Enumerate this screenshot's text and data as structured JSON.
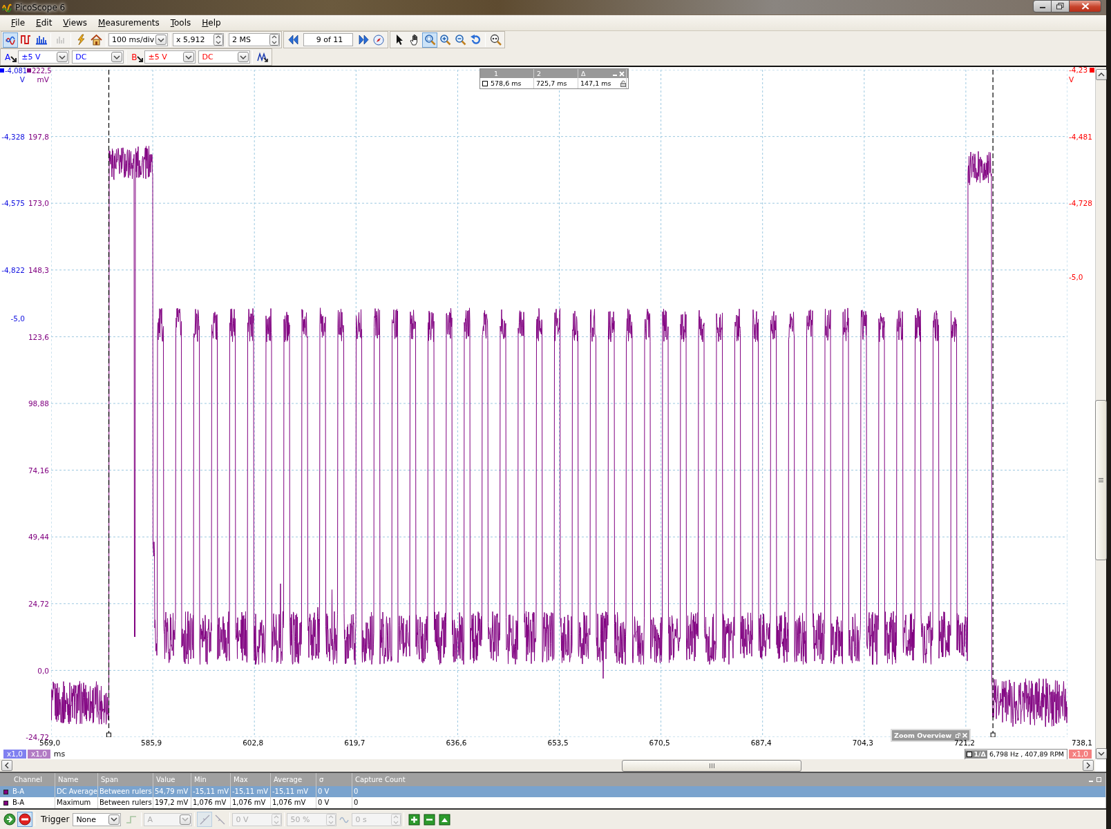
{
  "window": {
    "title": "PicoScope 6"
  },
  "menu": [
    {
      "label": "File"
    },
    {
      "label": "Edit"
    },
    {
      "label": "Views"
    },
    {
      "label": "Measurements"
    },
    {
      "label": "Tools"
    },
    {
      "label": "Help"
    }
  ],
  "toolbar": {
    "views": [
      {
        "selected": true,
        "disabled": false
      },
      {
        "selected": false,
        "disabled": false
      },
      {
        "selected": false,
        "disabled": false
      },
      {
        "selected": false,
        "disabled": true
      }
    ],
    "timebase": "100 ms/div",
    "zoom": "x 5,912",
    "samples": "2 MS",
    "buffer": "9  of 11",
    "tools": [
      {
        "selected": false
      },
      {
        "selected": false
      },
      {
        "selected": true
      },
      {
        "selected": false
      },
      {
        "selected": false
      },
      {
        "selected": false
      }
    ]
  },
  "channels": [
    {
      "name": "A",
      "range": "±5 V",
      "coupling": "DC",
      "color": "#0000ff"
    },
    {
      "name": "B",
      "range": "±5 V",
      "coupling": "DC",
      "color": "#ff0000"
    }
  ],
  "rulers": {
    "headers": [
      "1",
      "2",
      "Δ"
    ],
    "values": [
      "578,6 ms",
      "725,7 ms",
      "147,1 ms"
    ]
  },
  "scope": {
    "axis_a": {
      "unit": "V",
      "labels": [
        "-4,081",
        "-4,328",
        "-4,575",
        "-4,822",
        "-5,0"
      ]
    },
    "axis_math": {
      "unit": "mV",
      "labels": [
        "222,5",
        "197,8",
        "173,0",
        "148,3",
        "123,6",
        "98,88",
        "74,16",
        "49,44",
        "24,72",
        "0,0",
        "-24,72"
      ]
    },
    "axis_b": {
      "unit": "V",
      "labels": [
        "-4,23",
        "-4,481",
        "-4,728",
        "-5,0"
      ]
    },
    "x_axis": {
      "unit": "ms",
      "labels": [
        "569,0",
        "585,9",
        "602,8",
        "619,7",
        "636,6",
        "653,5",
        "670,5",
        "687,4",
        "704,3",
        "721,2",
        "738,1"
      ]
    },
    "scale_badges": [
      {
        "label": "x1,0",
        "color": "#8080f0"
      },
      {
        "label": "x1,0",
        "color": "#b27cc4"
      },
      {
        "label": "x1,0",
        "color": "#f48080"
      }
    ],
    "frequency": {
      "label": "1/Δ",
      "value": "6,798 Hz , 407,89 RPM"
    },
    "zoom_overview": {
      "title": "Zoom Overview"
    }
  },
  "measurements": {
    "columns": [
      "Channel",
      "Name",
      "Span",
      "Value",
      "Min",
      "Max",
      "Average",
      "σ",
      "Capture Count"
    ],
    "rows": [
      {
        "selected": true,
        "cells": [
          "B-A",
          "DC Average",
          "Between rulers",
          "54,79 mV",
          "-15,11 mV",
          "-15,11 mV",
          "-15,11 mV",
          "0 V",
          "0"
        ]
      },
      {
        "selected": false,
        "cells": [
          "B-A",
          "Maximum",
          "Between rulers",
          "197,2 mV",
          "1,076 mV",
          "1,076 mV",
          "1,076 mV",
          "0 V",
          "0"
        ]
      }
    ]
  },
  "trigger": {
    "label": "Trigger",
    "mode": "None",
    "source": "A",
    "threshold": "0 V",
    "pretrigger": "50 %",
    "delay": "0 s"
  }
}
